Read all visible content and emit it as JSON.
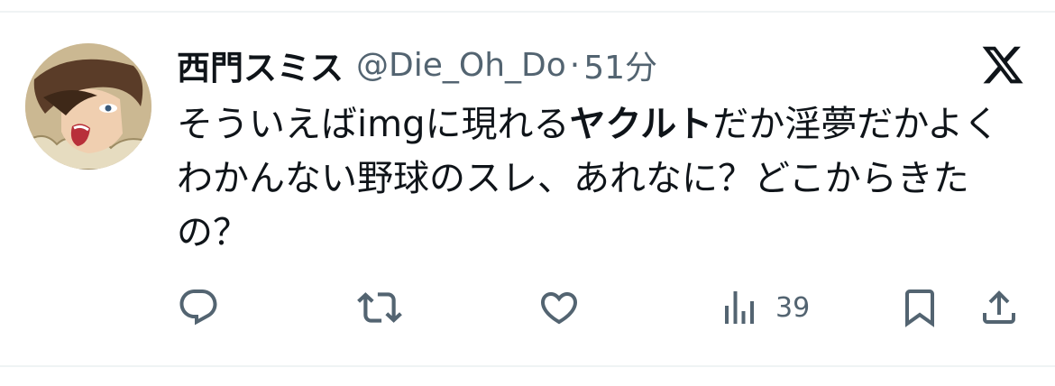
{
  "tweet": {
    "author": {
      "display_name": "西門スミス",
      "handle": "@Die_Oh_Do",
      "avatar_icon": "profile-avatar"
    },
    "separator": "·",
    "time": "51分",
    "body": {
      "part1": "そういえばimgに現れる",
      "bold": "ヤクルト",
      "part2": "だか淫夢だかよくわかんない野球のスレ、あれなに？どこからきたの？"
    },
    "views": "39",
    "icons": {
      "platform": "x-logo-icon",
      "reply": "reply-icon",
      "retweet": "retweet-icon",
      "like": "heart-icon",
      "views": "views-icon",
      "bookmark": "bookmark-icon",
      "share": "share-icon"
    },
    "colors": {
      "text": "#0f1419",
      "secondary": "#536471",
      "divider": "#eff3f4"
    }
  }
}
